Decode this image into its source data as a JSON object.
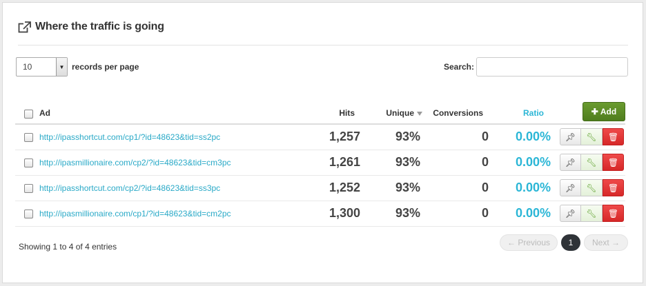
{
  "header": {
    "title": "Where the traffic is going",
    "icon": "external-link-icon"
  },
  "length": {
    "value": "10",
    "label": "records per page"
  },
  "search": {
    "label": "Search:",
    "value": "",
    "placeholder": ""
  },
  "table": {
    "columns": {
      "ad": "Ad",
      "hits": "Hits",
      "unique": "Unique",
      "conversions": "Conversions",
      "ratio": "Ratio"
    },
    "add_label": "Add",
    "rows": [
      {
        "ad": "http://ipasshortcut.com/cp1/?id=48623&tid=ss2pc",
        "hits": "1,257",
        "unique": "93%",
        "conversions": "0",
        "ratio": "0.00%"
      },
      {
        "ad": "http://ipasmillionaire.com/cp2/?id=48623&tid=cm3pc",
        "hits": "1,261",
        "unique": "93%",
        "conversions": "0",
        "ratio": "0.00%"
      },
      {
        "ad": "http://ipasshortcut.com/cp2/?id=48623&tid=ss3pc",
        "hits": "1,252",
        "unique": "93%",
        "conversions": "0",
        "ratio": "0.00%"
      },
      {
        "ad": "http://ipasmillionaire.com/cp1/?id=48623&tid=cm2pc",
        "hits": "1,300",
        "unique": "93%",
        "conversions": "0",
        "ratio": "0.00%"
      }
    ]
  },
  "footer": {
    "info": "Showing 1 to 4 of 4 entries",
    "prev_label": "← Previous",
    "current_page": "1",
    "next_label": "Next →"
  },
  "colors": {
    "accent": "#29a9c7",
    "ratio": "#2bb6d6",
    "add_button": "#5a8a25",
    "delete_button": "#e03434"
  }
}
